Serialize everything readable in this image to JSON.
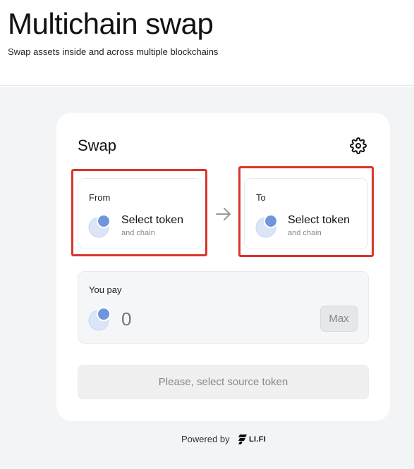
{
  "header": {
    "title": "Multichain swap",
    "subtitle": "Swap assets inside and across multiple blockchains"
  },
  "swap": {
    "title": "Swap",
    "settings_icon": "gear-icon",
    "from": {
      "label": "From",
      "token_text": "Select token",
      "chain_text": "and chain"
    },
    "to": {
      "label": "To",
      "token_text": "Select token",
      "chain_text": "and chain"
    },
    "arrow_icon": "arrow-right-icon",
    "pay": {
      "label": "You pay",
      "amount_placeholder": "0",
      "max_label": "Max"
    },
    "submit_label": "Please, select source token"
  },
  "footer": {
    "powered_by": "Powered by",
    "brand": "LI.FI"
  },
  "colors": {
    "highlight": "#d9352b",
    "coin_front": "#6f95dd",
    "coin_back": "#dce5f7",
    "page_background": "#f3f4f6"
  }
}
